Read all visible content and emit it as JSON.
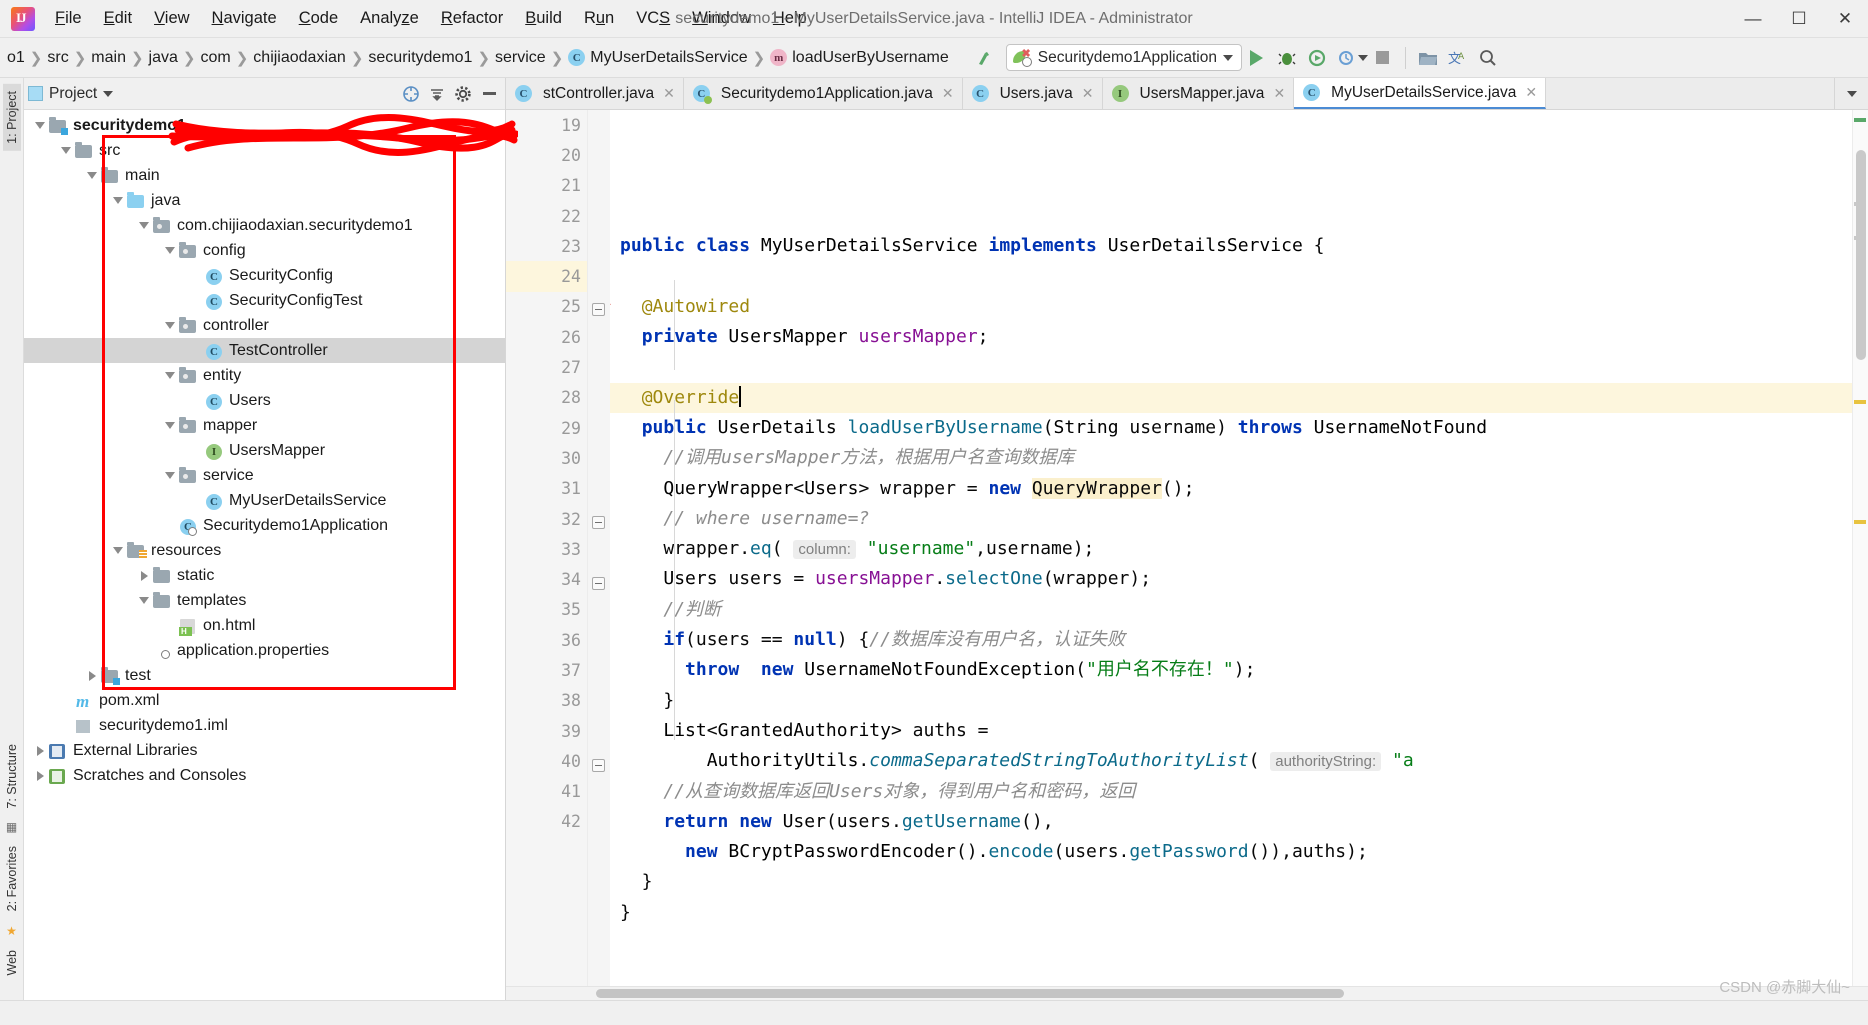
{
  "window": {
    "title": "securitydemo1 - MyUserDetailsService.java - IntelliJ IDEA - Administrator",
    "minimize": "—",
    "maximize": "☐",
    "close": "✕",
    "logo_text": "IJ"
  },
  "menubar": [
    {
      "label": "File",
      "mnemonic": "F"
    },
    {
      "label": "Edit",
      "mnemonic": "E"
    },
    {
      "label": "View",
      "mnemonic": "V"
    },
    {
      "label": "Navigate",
      "mnemonic": "N"
    },
    {
      "label": "Code",
      "mnemonic": "C"
    },
    {
      "label": "Analyze",
      "mnemonic": "z"
    },
    {
      "label": "Refactor",
      "mnemonic": "R"
    },
    {
      "label": "Build",
      "mnemonic": "B"
    },
    {
      "label": "Run",
      "mnemonic": "u"
    },
    {
      "label": "VCS",
      "mnemonic": "S"
    },
    {
      "label": "Window",
      "mnemonic": "W"
    },
    {
      "label": "Help",
      "mnemonic": "H"
    }
  ],
  "breadcrumbs": [
    {
      "label": "o1",
      "icon": ""
    },
    {
      "label": "src",
      "icon": ""
    },
    {
      "label": "main",
      "icon": ""
    },
    {
      "label": "java",
      "icon": ""
    },
    {
      "label": "com",
      "icon": ""
    },
    {
      "label": "chijiaodaxian",
      "icon": ""
    },
    {
      "label": "securitydemo1",
      "icon": ""
    },
    {
      "label": "service",
      "icon": ""
    },
    {
      "label": "MyUserDetailsService",
      "icon": "class-icon"
    },
    {
      "label": "loadUserByUsername",
      "icon": "method-icon"
    }
  ],
  "toolbar": {
    "run_config": "Securitydemo1Application",
    "run_config_icon": "spring-boot-icon",
    "dropdown_icon": "chevron-down-icon",
    "buttons": [
      {
        "name": "make-project-icon",
        "glyph": "↖"
      },
      {
        "name": "run-icon",
        "glyph": "▶"
      },
      {
        "name": "debug-icon",
        "glyph": "🐞"
      },
      {
        "name": "run-coverage-icon",
        "glyph": "↻"
      },
      {
        "name": "profiler-icon",
        "glyph": "⚙"
      },
      {
        "name": "stop-icon",
        "glyph": "■"
      },
      {
        "name": "open-folder-icon",
        "glyph": "🗁"
      },
      {
        "name": "translate-icon",
        "glyph": "文"
      },
      {
        "name": "search-everywhere-icon",
        "glyph": "🔍"
      }
    ]
  },
  "left_rail": {
    "items": [
      {
        "label": "1: Project",
        "active": true
      },
      {
        "label": "7: Structure",
        "active": false
      },
      {
        "label": "2: Favorites",
        "active": false
      },
      {
        "label": "Web",
        "active": false
      }
    ]
  },
  "project_panel": {
    "title": "Project",
    "tools": [
      {
        "name": "select-opened-file-icon",
        "glyph": "⊕"
      },
      {
        "name": "collapse-all-icon",
        "glyph": "↧"
      },
      {
        "name": "settings-gear-icon",
        "glyph": "⚙"
      },
      {
        "name": "hide-panel-icon",
        "glyph": "—"
      }
    ],
    "tree": [
      {
        "label": "securitydemo1",
        "depth": 0,
        "arrow": "down",
        "icon": "module-folder-icon",
        "bold": true,
        "selected": false
      },
      {
        "label": "src",
        "depth": 1,
        "arrow": "down",
        "icon": "folder-icon",
        "bold": false,
        "selected": false
      },
      {
        "label": "main",
        "depth": 2,
        "arrow": "down",
        "icon": "source-folder-icon",
        "bold": false,
        "selected": false
      },
      {
        "label": "java",
        "depth": 3,
        "arrow": "down",
        "icon": "java-source-folder-icon",
        "bold": false,
        "selected": false
      },
      {
        "label": "com.chijiaodaxian.securitydemo1",
        "depth": 4,
        "arrow": "down",
        "icon": "package-icon",
        "bold": false,
        "selected": false
      },
      {
        "label": "config",
        "depth": 5,
        "arrow": "down",
        "icon": "package-icon",
        "bold": false,
        "selected": false
      },
      {
        "label": "SecurityConfig",
        "depth": 6,
        "arrow": "none",
        "icon": "class-icon",
        "bold": false,
        "selected": false
      },
      {
        "label": "SecurityConfigTest",
        "depth": 6,
        "arrow": "none",
        "icon": "class-icon",
        "bold": false,
        "selected": false
      },
      {
        "label": "controller",
        "depth": 5,
        "arrow": "down",
        "icon": "package-icon",
        "bold": false,
        "selected": false
      },
      {
        "label": "TestController",
        "depth": 6,
        "arrow": "none",
        "icon": "class-icon",
        "bold": false,
        "selected": true
      },
      {
        "label": "entity",
        "depth": 5,
        "arrow": "down",
        "icon": "package-icon",
        "bold": false,
        "selected": false
      },
      {
        "label": "Users",
        "depth": 6,
        "arrow": "none",
        "icon": "class-icon",
        "bold": false,
        "selected": false
      },
      {
        "label": "mapper",
        "depth": 5,
        "arrow": "down",
        "icon": "package-icon",
        "bold": false,
        "selected": false
      },
      {
        "label": "UsersMapper",
        "depth": 6,
        "arrow": "none",
        "icon": "interface-icon",
        "bold": false,
        "selected": false
      },
      {
        "label": "service",
        "depth": 5,
        "arrow": "down",
        "icon": "package-icon",
        "bold": false,
        "selected": false
      },
      {
        "label": "MyUserDetailsService",
        "depth": 6,
        "arrow": "none",
        "icon": "class-icon",
        "bold": false,
        "selected": false
      },
      {
        "label": "Securitydemo1Application",
        "depth": 5,
        "arrow": "none",
        "icon": "spring-class-icon",
        "bold": false,
        "selected": false
      },
      {
        "label": "resources",
        "depth": 3,
        "arrow": "down",
        "icon": "resources-folder-icon",
        "bold": false,
        "selected": false
      },
      {
        "label": "static",
        "depth": 4,
        "arrow": "right",
        "icon": "folder-icon",
        "bold": false,
        "selected": false
      },
      {
        "label": "templates",
        "depth": 4,
        "arrow": "down",
        "icon": "folder-icon",
        "bold": false,
        "selected": false
      },
      {
        "label": "on.html",
        "depth": 5,
        "arrow": "none",
        "icon": "html-file-icon",
        "bold": false,
        "selected": false
      },
      {
        "label": "application.properties",
        "depth": 4,
        "arrow": "none",
        "icon": "spring-properties-icon",
        "bold": false,
        "selected": false
      },
      {
        "label": "test",
        "depth": 2,
        "arrow": "right",
        "icon": "test-folder-icon",
        "bold": false,
        "selected": false
      },
      {
        "label": "pom.xml",
        "depth": 1,
        "arrow": "none",
        "icon": "maven-file-icon",
        "bold": false,
        "selected": false
      },
      {
        "label": "securitydemo1.iml",
        "depth": 1,
        "arrow": "none",
        "icon": "iml-file-icon",
        "bold": false,
        "selected": false
      },
      {
        "label": "External Libraries",
        "depth": 0,
        "arrow": "right",
        "icon": "libraries-icon",
        "bold": false,
        "selected": false
      },
      {
        "label": "Scratches and Consoles",
        "depth": 0,
        "arrow": "right",
        "icon": "scratches-icon",
        "bold": false,
        "selected": false
      }
    ]
  },
  "editor": {
    "tabs": [
      {
        "label": "stController.java",
        "icon": "class-icon",
        "active": false
      },
      {
        "label": "Securitydemo1Application.java",
        "icon": "spring-class-icon",
        "active": false
      },
      {
        "label": "Users.java",
        "icon": "class-icon",
        "active": false
      },
      {
        "label": "UsersMapper.java",
        "icon": "interface-icon",
        "active": false
      },
      {
        "label": "MyUserDetailsService.java",
        "icon": "class-icon",
        "active": true
      }
    ],
    "tabs_more_icon": "chevron-down-icon",
    "first_line_number": 19,
    "current_line": 24,
    "lines": [
      {
        "n": 19,
        "gutter_icon": "class-gutter-icon"
      },
      {
        "n": 20,
        "gutter_icon": ""
      },
      {
        "n": 21,
        "gutter_icon": ""
      },
      {
        "n": 22,
        "gutter_icon": "bean-gutter-icon"
      },
      {
        "n": 23,
        "gutter_icon": ""
      },
      {
        "n": 24,
        "gutter_icon": "intention-bulb-icon"
      },
      {
        "n": 25,
        "gutter_icon": "implements-gutter-icon"
      },
      {
        "n": 26,
        "gutter_icon": ""
      },
      {
        "n": 27,
        "gutter_icon": ""
      },
      {
        "n": 28,
        "gutter_icon": ""
      },
      {
        "n": 29,
        "gutter_icon": ""
      },
      {
        "n": 30,
        "gutter_icon": ""
      },
      {
        "n": 31,
        "gutter_icon": ""
      },
      {
        "n": 32,
        "gutter_icon": ""
      },
      {
        "n": 33,
        "gutter_icon": ""
      },
      {
        "n": 34,
        "gutter_icon": ""
      },
      {
        "n": 35,
        "gutter_icon": ""
      },
      {
        "n": 36,
        "gutter_icon": ""
      },
      {
        "n": 37,
        "gutter_icon": ""
      },
      {
        "n": 38,
        "gutter_icon": ""
      },
      {
        "n": 39,
        "gutter_icon": ""
      },
      {
        "n": 40,
        "gutter_icon": ""
      },
      {
        "n": 41,
        "gutter_icon": ""
      },
      {
        "n": 42,
        "gutter_icon": ""
      }
    ],
    "code_text": {
      "l19": "public class MyUserDetailsService implements UserDetailsService {",
      "l21": "@Autowired",
      "l22": "private UsersMapper usersMapper;",
      "l24": "@Override",
      "l25": "public UserDetails loadUserByUsername(String username) throws UsernameNotFound",
      "l26": "//调用usersMapper方法，根据用户名查询数据库",
      "l27": "QueryWrapper<Users> wrapper = new QueryWrapper();",
      "l28": "// where username=?",
      "l29": "wrapper.eq( column: \"username\",username);",
      "l30": "Users users = usersMapper.selectOne(wrapper);",
      "l31": "//判断",
      "l32": "if(users == null) {//数据库没有用户名，认证失败",
      "l33": "throw  new UsernameNotFoundException(\"用户名不存在！\");",
      "l34": "}",
      "l35": "List<GrantedAuthority> auths =",
      "l36": "AuthorityUtils.commaSeparatedStringToAuthorityList( authorityString: \"a",
      "l37": "//从查询数据库返回Users对象，得到用户名和密码，返回",
      "l38": "return new User(users.getUsername(),",
      "l39": "new BCryptPasswordEncoder().encode(users.getPassword()),auths);",
      "l40": "}",
      "l41": "}"
    },
    "hints": {
      "column": "column:",
      "authorityString": "authorityString:"
    }
  },
  "watermark": "CSDN @赤脚大仙~",
  "colors": {
    "accent": "#4b8bd4",
    "annotation_red": "#ff0000",
    "keyword": "#0033b3",
    "string": "#067d17",
    "comment": "#8c8c8c",
    "field": "#871094",
    "annotation_yellow": "#9e880d",
    "green_run": "#59a869"
  }
}
